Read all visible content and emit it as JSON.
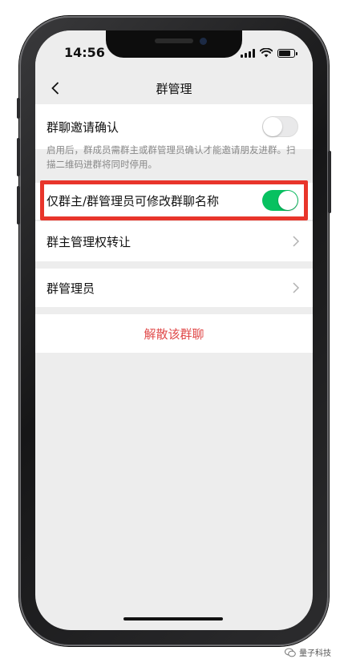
{
  "status_bar": {
    "time": "14:56",
    "battery_level": 0.85
  },
  "nav": {
    "title": "群管理"
  },
  "settings": {
    "invite_confirm": {
      "label": "群聊邀请确认",
      "enabled": false
    },
    "invite_desc": "启用后，群成员需群主或群管理员确认才能邀请朋友进群。扫描二维码进群将同时停用。",
    "admin_rename_only": {
      "label": "仅群主/群管理员可修改群聊名称",
      "enabled": true
    },
    "transfer_owner": {
      "label": "群主管理权转让"
    },
    "admins": {
      "label": "群管理员"
    },
    "dissolve": {
      "label": "解散该群聊"
    }
  },
  "watermark": {
    "text": "量子科技"
  },
  "colors": {
    "toggle_on": "#07c160",
    "highlight_border": "#e8352b",
    "danger_text": "#e04949"
  },
  "icons": [
    "back-chevron-icon",
    "signal-icon",
    "wifi-icon",
    "battery-icon",
    "chevron-right-icon",
    "wechat-icon"
  ]
}
